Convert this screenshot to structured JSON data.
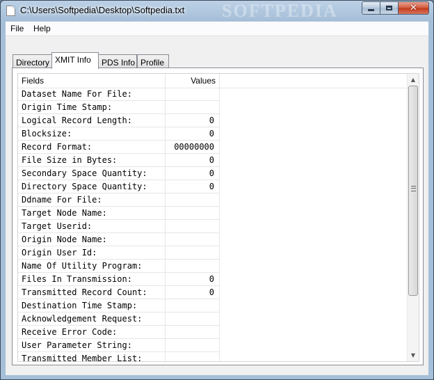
{
  "window": {
    "title": "C:\\Users\\Softpedia\\Desktop\\Softpedia.txt",
    "watermark": "SOFTPEDIA"
  },
  "menu": {
    "items": [
      "File",
      "Help"
    ]
  },
  "tabs": [
    "Directory",
    "XMIT Info",
    "PDS Info",
    "Profile"
  ],
  "active_tab": "XMIT Info",
  "grid": {
    "columns": [
      "Fields",
      "Values"
    ],
    "rows": [
      {
        "field": "Dataset Name For File:",
        "value": ""
      },
      {
        "field": "Origin Time Stamp:",
        "value": ""
      },
      {
        "field": "Logical Record Length:",
        "value": "0"
      },
      {
        "field": "Blocksize:",
        "value": "0"
      },
      {
        "field": "Record Format:",
        "value": "00000000"
      },
      {
        "field": "File Size in Bytes:",
        "value": "0"
      },
      {
        "field": "Secondary Space Quantity:",
        "value": "0"
      },
      {
        "field": "Directory Space Quantity:",
        "value": "0"
      },
      {
        "field": "Ddname For File:",
        "value": ""
      },
      {
        "field": "Target Node Name:",
        "value": ""
      },
      {
        "field": "Target Userid:",
        "value": ""
      },
      {
        "field": "Origin Node Name:",
        "value": ""
      },
      {
        "field": "Origin User Id:",
        "value": ""
      },
      {
        "field": "Name Of Utility Program:",
        "value": ""
      },
      {
        "field": "Files In Transmission:",
        "value": "0"
      },
      {
        "field": "Transmitted Record Count:",
        "value": "0"
      },
      {
        "field": "Destination Time Stamp:",
        "value": ""
      },
      {
        "field": "Acknowledgement Request:",
        "value": ""
      },
      {
        "field": "Receive Error Code:",
        "value": ""
      },
      {
        "field": "User Parameter String:",
        "value": ""
      },
      {
        "field": "Transmitted Member List:",
        "value": ""
      }
    ]
  }
}
